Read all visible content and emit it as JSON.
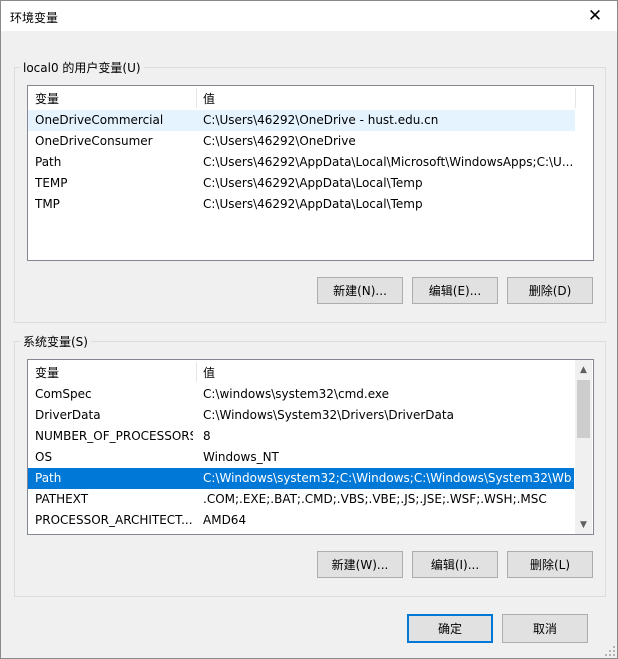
{
  "window": {
    "title": "环境变量",
    "close_icon": "close-icon"
  },
  "user_vars": {
    "group_label": "local0 的用户变量(U)",
    "columns": [
      "变量",
      "值"
    ],
    "rows": [
      {
        "name": "OneDriveCommercial",
        "value": "C:\\Users\\46292\\OneDrive - hust.edu.cn"
      },
      {
        "name": "OneDriveConsumer",
        "value": "C:\\Users\\46292\\OneDrive"
      },
      {
        "name": "Path",
        "value": "C:\\Users\\46292\\AppData\\Local\\Microsoft\\WindowsApps;C:\\U..."
      },
      {
        "name": "TEMP",
        "value": "C:\\Users\\46292\\AppData\\Local\\Temp"
      },
      {
        "name": "TMP",
        "value": "C:\\Users\\46292\\AppData\\Local\\Temp"
      }
    ],
    "hovered_row": 0,
    "buttons": {
      "new": "新建(N)...",
      "edit": "编辑(E)...",
      "delete": "删除(D)"
    }
  },
  "system_vars": {
    "group_label": "系统变量(S)",
    "columns": [
      "变量",
      "值"
    ],
    "rows": [
      {
        "name": "ComSpec",
        "value": "C:\\windows\\system32\\cmd.exe"
      },
      {
        "name": "DriverData",
        "value": "C:\\Windows\\System32\\Drivers\\DriverData"
      },
      {
        "name": "NUMBER_OF_PROCESSORS",
        "value": "8"
      },
      {
        "name": "OS",
        "value": "Windows_NT"
      },
      {
        "name": "Path",
        "value": "C:\\Windows\\system32;C:\\Windows;C:\\Windows\\System32\\Wb..."
      },
      {
        "name": "PATHEXT",
        "value": ".COM;.EXE;.BAT;.CMD;.VBS;.VBE;.JS;.JSE;.WSF;.WSH;.MSC"
      },
      {
        "name": "PROCESSOR_ARCHITECT...",
        "value": "AMD64"
      }
    ],
    "selected_row": 4,
    "buttons": {
      "new": "新建(W)...",
      "edit": "编辑(I)...",
      "delete": "删除(L)"
    }
  },
  "dialog_buttons": {
    "ok": "确定",
    "cancel": "取消"
  },
  "colors": {
    "selection": "#0078d7",
    "hover": "#e5f3ff",
    "default_button_border": "#0078d7"
  }
}
